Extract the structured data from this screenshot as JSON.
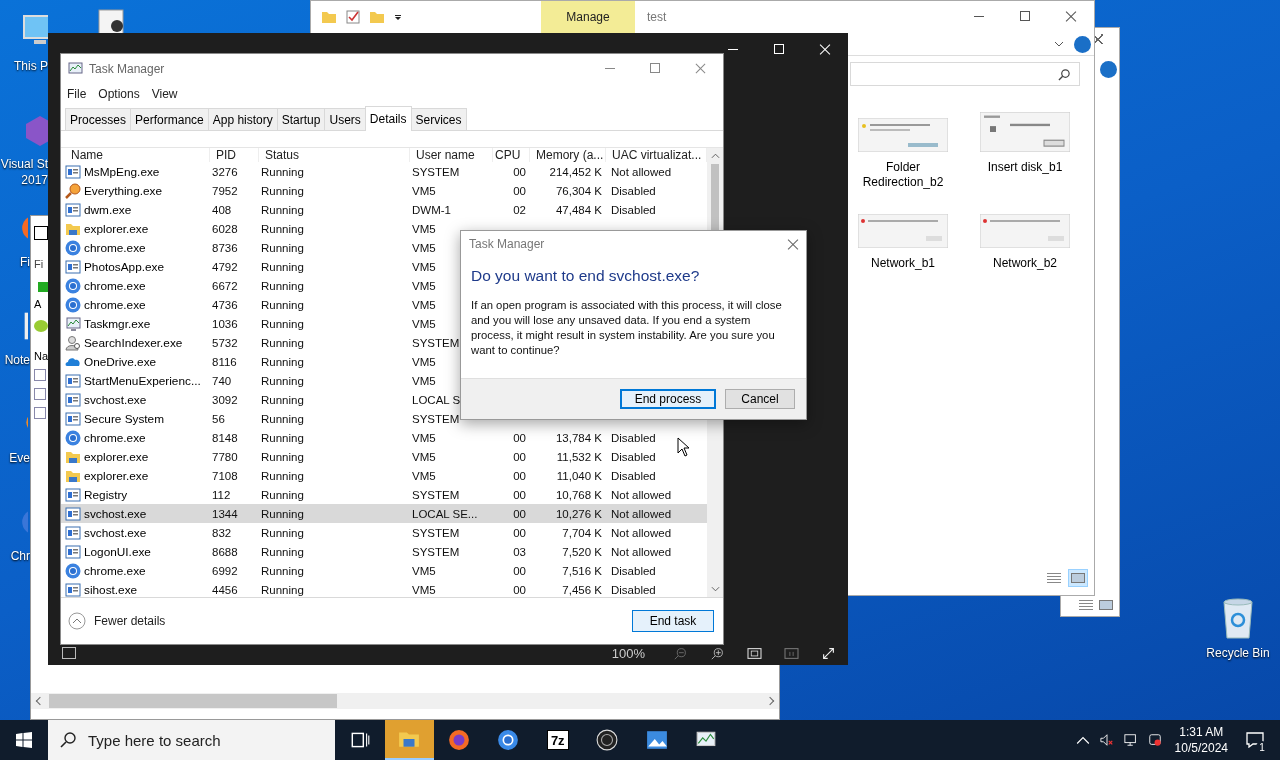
{
  "desktop": {
    "icons": [
      {
        "kind": "pc",
        "lines": [
          "This P"
        ]
      },
      {
        "kind": "vs",
        "lines": [
          "Visual St",
          "2017"
        ]
      },
      {
        "kind": "firefox",
        "lines": [
          "Fi"
        ]
      },
      {
        "kind": "notepad",
        "lines": [
          "Note"
        ]
      },
      {
        "kind": "everything",
        "lines": [
          "Eve"
        ]
      },
      {
        "kind": "chrome",
        "lines": [
          "Chr"
        ]
      }
    ],
    "recycle_bin": {
      "label": "Recycle Bin"
    }
  },
  "archive_window": {
    "texts": [
      "Fi",
      "A",
      "Na"
    ]
  },
  "explorer": {
    "title": "test",
    "context_tab": "Manage",
    "files": [
      {
        "label": "Folder Redirection_b2"
      },
      {
        "label": "Insert disk_b1"
      },
      {
        "label": "Network_b1"
      },
      {
        "label": "Network_b2"
      }
    ],
    "view_buttons": [
      {
        "kind": "details",
        "selected": false
      },
      {
        "kind": "large-icons",
        "selected": true
      }
    ]
  },
  "photos": {
    "zoom": "100%"
  },
  "task_manager": {
    "title": "Task Manager",
    "menu": [
      "File",
      "Options",
      "View"
    ],
    "tabs": [
      {
        "label": "Processes",
        "selected": false
      },
      {
        "label": "Performance",
        "selected": false
      },
      {
        "label": "App history",
        "selected": false
      },
      {
        "label": "Startup",
        "selected": false
      },
      {
        "label": "Users",
        "selected": false
      },
      {
        "label": "Details",
        "selected": true
      },
      {
        "label": "Services",
        "selected": false
      }
    ],
    "columns": [
      "Name",
      "PID",
      "Status",
      "User name",
      "CPU",
      "Memory (a...",
      "UAC virtualizat..."
    ],
    "rows": [
      {
        "kind": "app",
        "name": "MsMpEng.exe",
        "pid": "3276",
        "status": "Running",
        "user": "SYSTEM",
        "cpu": "00",
        "memory": "214,452 K",
        "uac": "Not allowed",
        "selected": false
      },
      {
        "kind": "search",
        "name": "Everything.exe",
        "pid": "7952",
        "status": "Running",
        "user": "VM5",
        "cpu": "00",
        "memory": "76,304 K",
        "uac": "Disabled",
        "selected": false
      },
      {
        "kind": "app",
        "name": "dwm.exe",
        "pid": "408",
        "status": "Running",
        "user": "DWM-1",
        "cpu": "02",
        "memory": "47,484 K",
        "uac": "Disabled",
        "selected": false
      },
      {
        "kind": "explorer",
        "name": "explorer.exe",
        "pid": "6028",
        "status": "Running",
        "user": "VM5",
        "selected": false
      },
      {
        "kind": "chrome",
        "name": "chrome.exe",
        "pid": "8736",
        "status": "Running",
        "user": "VM5",
        "selected": false
      },
      {
        "kind": "app",
        "name": "PhotosApp.exe",
        "pid": "4792",
        "status": "Running",
        "user": "VM5",
        "selected": false
      },
      {
        "kind": "chrome",
        "name": "chrome.exe",
        "pid": "6672",
        "status": "Running",
        "user": "VM5",
        "selected": false
      },
      {
        "kind": "chrome",
        "name": "chrome.exe",
        "pid": "4736",
        "status": "Running",
        "user": "VM5",
        "selected": false
      },
      {
        "kind": "taskmgr",
        "name": "Taskmgr.exe",
        "pid": "1036",
        "status": "Running",
        "user": "VM5",
        "selected": false
      },
      {
        "kind": "indexer",
        "name": "SearchIndexer.exe",
        "pid": "5732",
        "status": "Running",
        "user": "SYSTEM",
        "selected": false
      },
      {
        "kind": "cloud",
        "name": "OneDrive.exe",
        "pid": "8116",
        "status": "Running",
        "user": "VM5",
        "selected": false
      },
      {
        "kind": "app",
        "name": "StartMenuExperienc...",
        "pid": "740",
        "status": "Running",
        "user": "VM5",
        "selected": false
      },
      {
        "kind": "app",
        "name": "svchost.exe",
        "pid": "3092",
        "status": "Running",
        "user": "LOCAL S",
        "selected": false
      },
      {
        "kind": "app",
        "name": "Secure System",
        "pid": "56",
        "status": "Running",
        "user": "SYSTEM",
        "selected": false
      },
      {
        "kind": "chrome",
        "name": "chrome.exe",
        "pid": "8148",
        "status": "Running",
        "user": "VM5",
        "cpu": "00",
        "memory": "13,784 K",
        "uac": "Disabled",
        "selected": false
      },
      {
        "kind": "explorer",
        "name": "explorer.exe",
        "pid": "7780",
        "status": "Running",
        "user": "VM5",
        "cpu": "00",
        "memory": "11,532 K",
        "uac": "Disabled",
        "selected": false
      },
      {
        "kind": "explorer",
        "name": "explorer.exe",
        "pid": "7108",
        "status": "Running",
        "user": "VM5",
        "cpu": "00",
        "memory": "11,040 K",
        "uac": "Disabled",
        "selected": false
      },
      {
        "kind": "app",
        "name": "Registry",
        "pid": "112",
        "status": "Running",
        "user": "SYSTEM",
        "cpu": "00",
        "memory": "10,768 K",
        "uac": "Not allowed",
        "selected": false
      },
      {
        "kind": "app",
        "name": "svchost.exe",
        "pid": "1344",
        "status": "Running",
        "user": "LOCAL SE...",
        "cpu": "00",
        "memory": "10,276 K",
        "uac": "Not allowed",
        "selected": true
      },
      {
        "kind": "app",
        "name": "svchost.exe",
        "pid": "832",
        "status": "Running",
        "user": "SYSTEM",
        "cpu": "00",
        "memory": "7,704 K",
        "uac": "Not allowed",
        "selected": false
      },
      {
        "kind": "app",
        "name": "LogonUI.exe",
        "pid": "8688",
        "status": "Running",
        "user": "SYSTEM",
        "cpu": "03",
        "memory": "7,520 K",
        "uac": "Not allowed",
        "selected": false
      },
      {
        "kind": "chrome",
        "name": "chrome.exe",
        "pid": "6992",
        "status": "Running",
        "user": "VM5",
        "cpu": "00",
        "memory": "7,516 K",
        "uac": "Disabled",
        "selected": false
      },
      {
        "kind": "app",
        "name": "sihost.exe",
        "pid": "4456",
        "status": "Running",
        "user": "VM5",
        "cpu": "00",
        "memory": "7,456 K",
        "uac": "Disabled",
        "selected": false
      }
    ],
    "fewer_details": "Fewer details",
    "end_task": "End task"
  },
  "dialog": {
    "title": "Task Manager",
    "heading": "Do you want to end svchost.exe?",
    "body": "If an open program is associated with this process, it will close and you will lose any unsaved data. If you end a system process, it might result in system instability. Are you sure you want to continue?",
    "buttons": [
      {
        "label": "End process",
        "default": true
      },
      {
        "label": "Cancel",
        "default": false
      }
    ]
  },
  "taskbar": {
    "search_placeholder": "Type here to search",
    "apps": [
      {
        "kind": "task-view",
        "active": false
      },
      {
        "kind": "explorer",
        "active": true
      },
      {
        "kind": "firefox",
        "active": false
      },
      {
        "kind": "chrome",
        "active": false
      },
      {
        "kind": "sevenzip",
        "text": "7z",
        "active": false
      },
      {
        "kind": "cpuz",
        "active": false
      },
      {
        "kind": "photos",
        "active": false
      },
      {
        "kind": "taskmgr",
        "active": false
      }
    ],
    "time": "1:31 AM",
    "date": "10/5/2024",
    "notifications": "1"
  }
}
